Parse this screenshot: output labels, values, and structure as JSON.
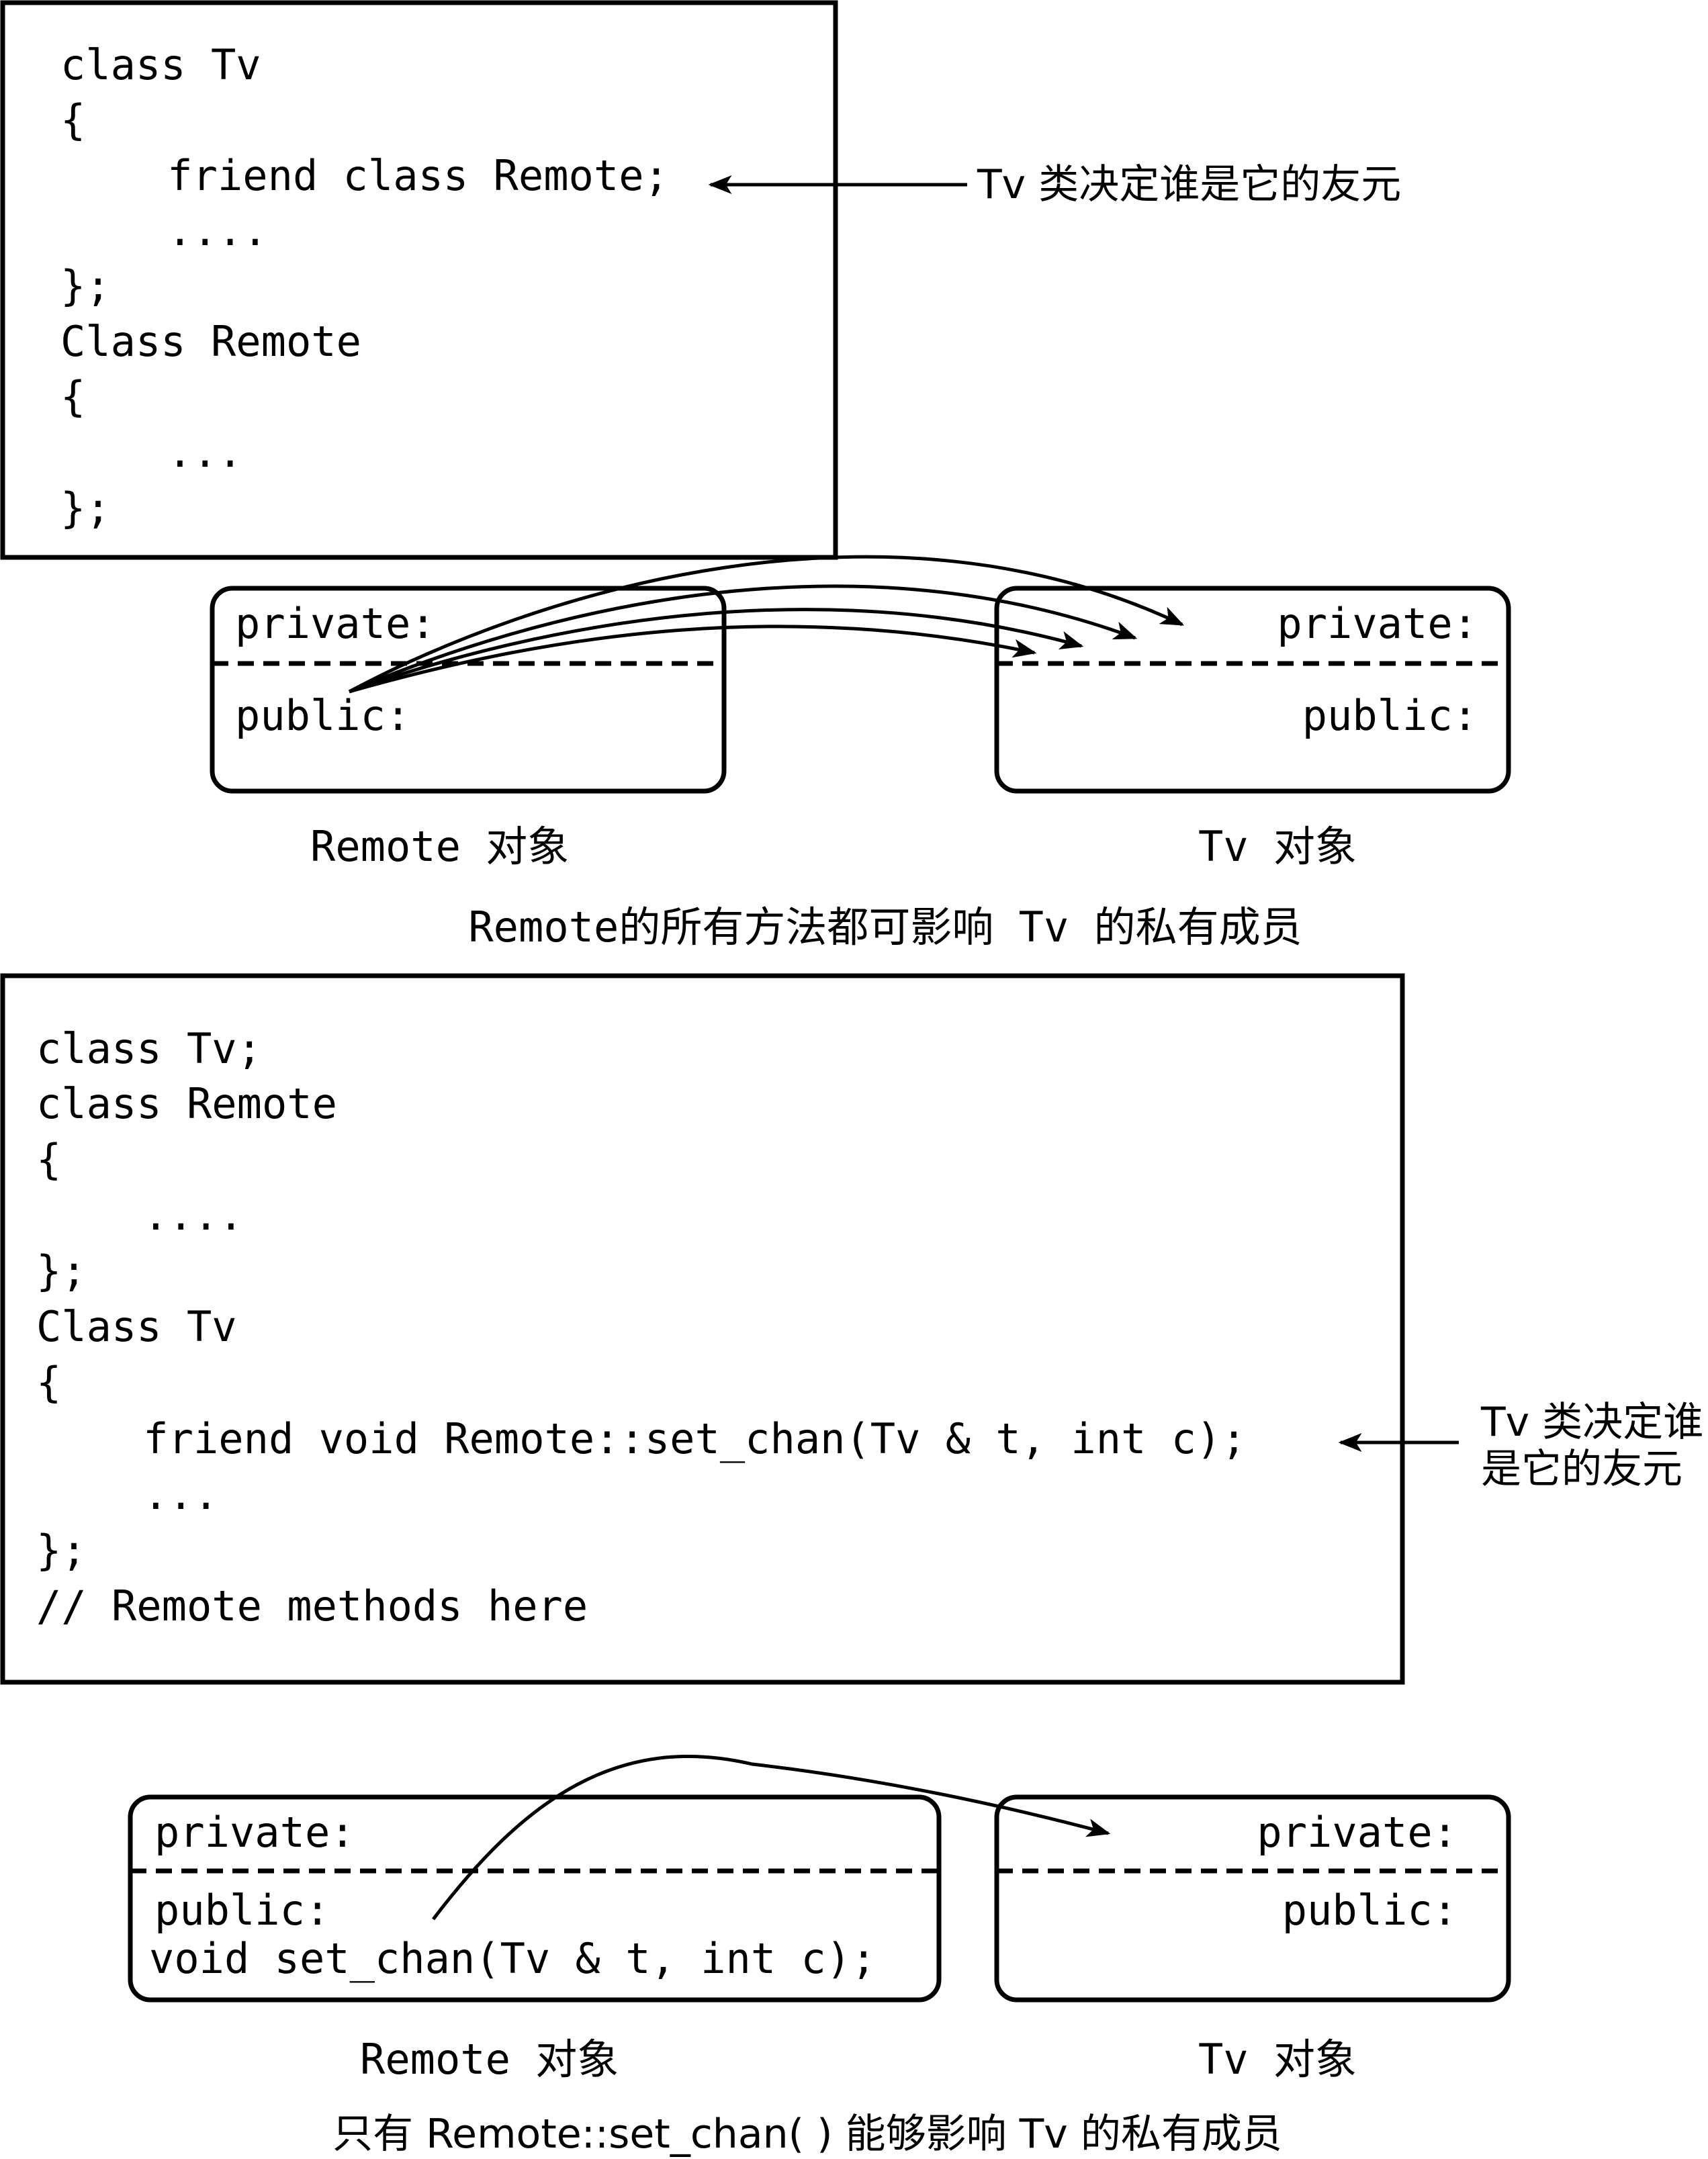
{
  "top_section": {
    "code_lines": [
      "class Tv",
      "{",
      "    friend class Remote;",
      "    ....",
      "};",
      "Class Remote",
      "{",
      "    ...",
      "};"
    ],
    "annotation": "Tv 类决定谁是它的友元",
    "remote_box": {
      "private_label": "private:",
      "public_label": "public:"
    },
    "tv_box": {
      "private_label": "private:",
      "public_label": "public:"
    },
    "remote_caption": "Remote 对象",
    "tv_caption": "Tv 对象",
    "summary": "Remote的所有方法都可影响 Tv 的私有成员"
  },
  "bottom_section": {
    "code_lines": [
      "class Tv;",
      "class Remote",
      "{",
      "    ....",
      "};",
      "Class Tv",
      "{",
      "    friend void Remote::set_chan(Tv & t, int c);",
      "    ...",
      "};",
      "// Remote methods here"
    ],
    "annotation_line1": "Tv 类决定谁",
    "annotation_line2": "是它的友元",
    "remote_box": {
      "private_label": "private:",
      "public_label": "public:",
      "method_label": "void set_chan(Tv & t, int c);"
    },
    "tv_box": {
      "private_label": "private:",
      "public_label": "public:"
    },
    "remote_caption": "Remote 对象",
    "tv_caption": "Tv 对象",
    "summary": "只有 Remote::set_chan( ) 能够影响 Tv 的私有成员"
  }
}
